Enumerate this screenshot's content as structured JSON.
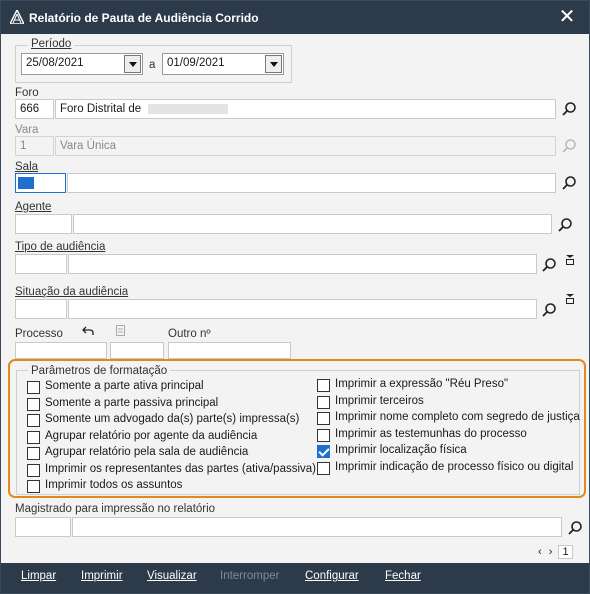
{
  "window": {
    "title": "Relatório de Pauta de Audiência Corrido",
    "close_icon": "close-icon"
  },
  "periodo": {
    "label": "Período",
    "start": "25/08/2021",
    "sep": "a",
    "end": "01/09/2021"
  },
  "foro": {
    "label": "Foro",
    "code": "666",
    "name": "Foro Distrital de"
  },
  "vara": {
    "label": "Vara",
    "code": "1",
    "name": "Vara Única"
  },
  "sala": {
    "label": "Sala",
    "code": "",
    "name": ""
  },
  "agente": {
    "label": "Agente",
    "code": "",
    "name": ""
  },
  "tipo": {
    "label": "Tipo de audiência",
    "code": "",
    "name": ""
  },
  "situacao": {
    "label": "Situação da audiência",
    "code": "",
    "name": ""
  },
  "processo": {
    "label": "Processo",
    "outro_label": "Outro nº"
  },
  "formatacao": {
    "legend": "Parâmetros de formatação",
    "left": [
      {
        "label": "Somente a parte ativa principal",
        "checked": false
      },
      {
        "label": "Somente a parte passiva principal",
        "checked": false
      },
      {
        "label": "Somente um advogado da(s) parte(s) impressa(s)",
        "checked": false
      },
      {
        "label": "Agrupar relatório por agente da audiência",
        "checked": false
      },
      {
        "label": "Agrupar relatório pela sala de audiência",
        "checked": false
      },
      {
        "label": "Imprimir os representantes das partes (ativa/passiva)",
        "checked": false
      },
      {
        "label": "Imprimir todos os assuntos",
        "checked": false
      }
    ],
    "right": [
      {
        "label": "Imprimir a expressão \"Réu Preso\"",
        "checked": false
      },
      {
        "label": "Imprimir terceiros",
        "checked": false
      },
      {
        "label": "Imprimir nome completo com segredo de justiça",
        "checked": false
      },
      {
        "label": "Imprimir as testemunhas do processo",
        "checked": false
      },
      {
        "label": "Imprimir localização física",
        "checked": true
      },
      {
        "label": "Imprimir indicação de processo físico ou digital",
        "checked": false
      }
    ]
  },
  "magistrado": {
    "label": "Magistrado para impressão no relatório",
    "code": "",
    "name": ""
  },
  "pager": {
    "page": "1"
  },
  "buttons": {
    "limpar": "Limpar",
    "imprimir": "Imprimir",
    "visualizar": "Visualizar",
    "interromper": "Interromper",
    "configurar": "Configurar",
    "fechar": "Fechar"
  }
}
